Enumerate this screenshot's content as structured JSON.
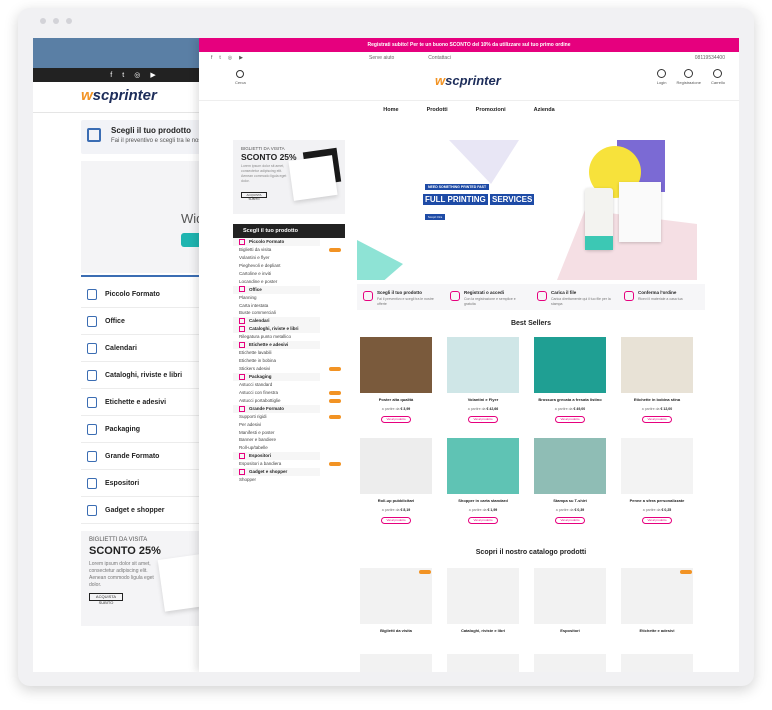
{
  "promo": "Registrati subito! Per te un buono SCONTO del 10% da utilizzare sul tuo primo ordine",
  "topbar": {
    "help": "Serve aiuto",
    "contacts": "Contattaci",
    "phone": "08119534400"
  },
  "logo": {
    "pre": "w",
    "brand": "scprinter"
  },
  "header": {
    "search": "Cerca",
    "login": "Login",
    "register": "Registrazione",
    "cart": "Carrello"
  },
  "nav": [
    "Home",
    "Prodotti",
    "Promozioni",
    "Azienda"
  ],
  "sidebar": {
    "ad": {
      "kicker": "BIGLIETTI DA VISITA",
      "title": "SCONTO 25%",
      "btn": "ACQUISTA SUBITO"
    },
    "heading": "Scegli il tuo prodotto",
    "rows": [
      {
        "label": "Piccolo Formato",
        "cat": true
      },
      {
        "label": "Biglietti da visita",
        "tag": true
      },
      {
        "label": "Volantini e flyer"
      },
      {
        "label": "Pieghevoli e depliant"
      },
      {
        "label": "Cartoline e inviti"
      },
      {
        "label": "Locandine e poster"
      },
      {
        "label": "Office",
        "cat": true
      },
      {
        "label": "Planning"
      },
      {
        "label": "Carta intestata"
      },
      {
        "label": "Buste commerciali"
      },
      {
        "label": "Calendari",
        "cat": true
      },
      {
        "label": "Cataloghi, riviste e libri",
        "cat": true
      },
      {
        "label": "Rilegatura punto metallico"
      },
      {
        "label": "Etichette e adesivi",
        "cat": true
      },
      {
        "label": "Etichette lavabili"
      },
      {
        "label": "Etichette in bobina"
      },
      {
        "label": "Stickers adesivi",
        "tag": true
      },
      {
        "label": "Packaging",
        "cat": true
      },
      {
        "label": "Astucci standard"
      },
      {
        "label": "Astucci con finestra",
        "tag": true
      },
      {
        "label": "Astucci portabottiglie",
        "tag": true
      },
      {
        "label": "Grande Formato",
        "cat": true
      },
      {
        "label": "Supporti rigidi",
        "tag": true
      },
      {
        "label": "Per adesivi"
      },
      {
        "label": "Manifesti e poster"
      },
      {
        "label": "Banner e bandiere"
      },
      {
        "label": "Roll-up/tabelle"
      },
      {
        "label": "Espositori",
        "cat": true
      },
      {
        "label": "Espositori a bandiera",
        "tag": true
      },
      {
        "label": "Gadget e shopper",
        "cat": true
      },
      {
        "label": "Shopper"
      }
    ]
  },
  "hero": {
    "kicker": "NEED SOMETHING PRINTED FAST",
    "title": "FULL PRINTING",
    "title_accent": "SERVICES",
    "btn": "Scopri Ora"
  },
  "steps": [
    {
      "title": "Scegli il tuo prodotto",
      "desc": "Fai il preventivo e scegli tra le nostre offerte"
    },
    {
      "title": "Registrati o accedi",
      "desc": "Con la registrazione e semplice e gratuita"
    },
    {
      "title": "Carica il file",
      "desc": "Carica direttamente qui il tuo file per la stampa"
    },
    {
      "title": "Conferma l'ordine",
      "desc": "Ricevi il materiale a casa tua"
    }
  ],
  "bestsellers_title": "Best Sellers",
  "products": [
    {
      "name": "Poster alta qualità",
      "price": "€ 3,99",
      "color": "#7a5a3c"
    },
    {
      "name": "Volantini e Flyer",
      "price": "€ 42,66",
      "color": "#cfe6e7"
    },
    {
      "name": "Brossura grecata a fresata listino",
      "price": "€ 49,00",
      "color": "#1f9f93"
    },
    {
      "name": "Etichette in bobina stina",
      "price": "€ 12,00",
      "color": "#e8e2d6"
    },
    {
      "name": "Roll-up pubblicitari",
      "price": "€ 8,19",
      "color": "#ededed"
    },
    {
      "name": "Shopper in carta standard",
      "price": "€ 1,99",
      "color": "#5fc3b4"
    },
    {
      "name": "Stampa su T-shirt",
      "price": "€ 0,39",
      "color": "#8fbdb5"
    },
    {
      "name": "Penne a sfera personalizzate",
      "price": "€ 0,25",
      "color": "#f3f3f3"
    }
  ],
  "price_prefix": "a partire da",
  "btn_label": "Vai al prodotto",
  "catalog_title": "Scopri il nostro catalogo prodotti",
  "catalog": [
    {
      "name": "Biglietti da visita",
      "tag": true
    },
    {
      "name": "Cataloghi, riviste e libri"
    },
    {
      "name": "Espositori"
    },
    {
      "name": "Etichette e adesivi",
      "tag": true
    }
  ],
  "back": {
    "scegli_title": "Scegli il tuo prodotto",
    "scegli_desc": "Fai il preventivo e scegli tra le nostre",
    "wid": "Wid",
    "menu": [
      "Piccolo Formato",
      "Office",
      "Calendari",
      "Cataloghi, riviste e libri",
      "Etichette e adesivi",
      "Packaging",
      "Grande Formato",
      "Espositori",
      "Gadget e shopper"
    ],
    "ad_kicker": "BIGLIETTI DA VISITA",
    "ad_title": "SCONTO 25%",
    "ad_desc": "Lorem ipsum dolor sit amet, consectetur adipiscing elit. Aenean commodo ligula eget dolor.",
    "ad_btn": "ACQUISTA SUBITO"
  },
  "colors": {
    "accent": "#e6007e",
    "orange": "#f29324",
    "navy": "#1d2d5a"
  }
}
